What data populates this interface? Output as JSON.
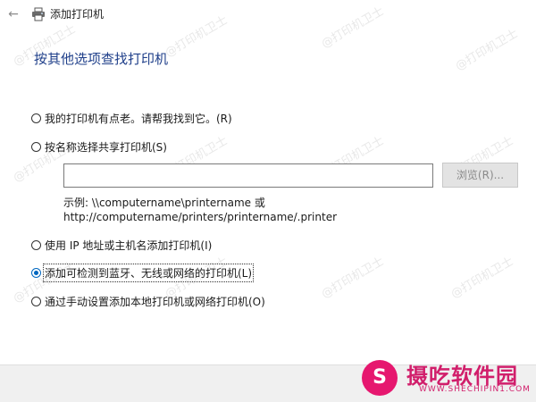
{
  "window": {
    "back_icon": "←",
    "title": "添加打印机",
    "printer_icon": "printer-icon"
  },
  "heading": "按其他选项查找打印机",
  "options": [
    {
      "label": "我的打印机有点老。请帮我找到它。(R)",
      "checked": false
    },
    {
      "label": "按名称选择共享打印机(S)",
      "checked": false
    },
    {
      "label": "使用 IP 地址或主机名添加打印机(I)",
      "checked": false
    },
    {
      "label": "添加可检测到蓝牙、无线或网络的打印机(L)",
      "checked": true
    },
    {
      "label": "通过手动设置添加本地打印机或网络打印机(O)",
      "checked": false
    }
  ],
  "share": {
    "value": "",
    "browse_label": "浏览(R)...",
    "example_line1": "示例: \\\\computername\\printername 或",
    "example_line2": "http://computername/printers/printername/.printer"
  },
  "watermark": {
    "text": "@打印机卫士"
  },
  "brand": {
    "name": "摄吃软件园",
    "url": "WWW.SHECHIPIN1.COM",
    "color": "#d11e6b"
  },
  "colors": {
    "heading": "#1f3f8a",
    "radio_selected": "#0067c0",
    "footer_bg": "#f0f0f0"
  }
}
